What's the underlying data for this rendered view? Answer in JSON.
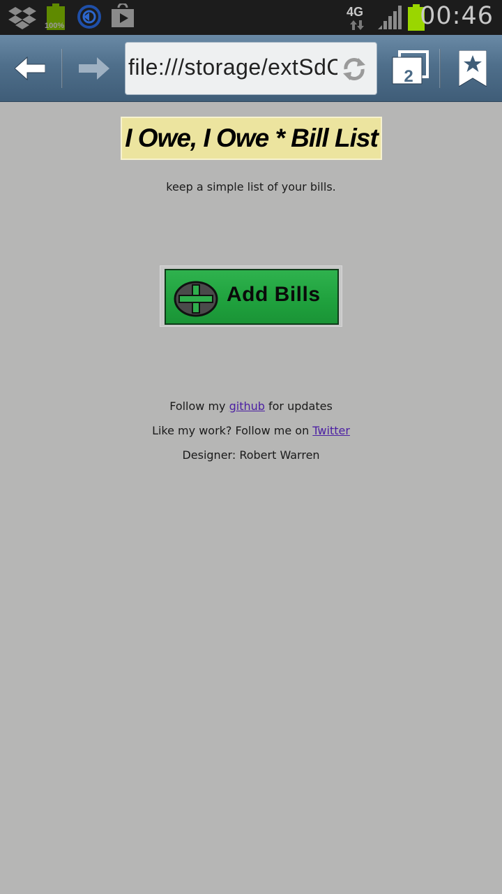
{
  "status_bar": {
    "battery_percent": "100%",
    "network": "4G",
    "time": "00:46"
  },
  "browser": {
    "url": "file:///storage/extSdCard",
    "tab_count": "2"
  },
  "page": {
    "banner_title": "I Owe, I Owe * Bill List",
    "tagline": "keep a simple list of your bills.",
    "add_button_label": "Add Bills",
    "footer": {
      "github_prefix": "Follow my ",
      "github_link": "github",
      "github_suffix": " for updates",
      "twitter_prefix": "Like my work? Follow me on ",
      "twitter_link": "Twitter",
      "designer": "Designer: Robert Warren"
    }
  },
  "colors": {
    "page_background": "#b6b6b5",
    "banner_background": "#ece49f",
    "add_button_green": "#20a23e",
    "link_color": "#4b1fa3"
  }
}
